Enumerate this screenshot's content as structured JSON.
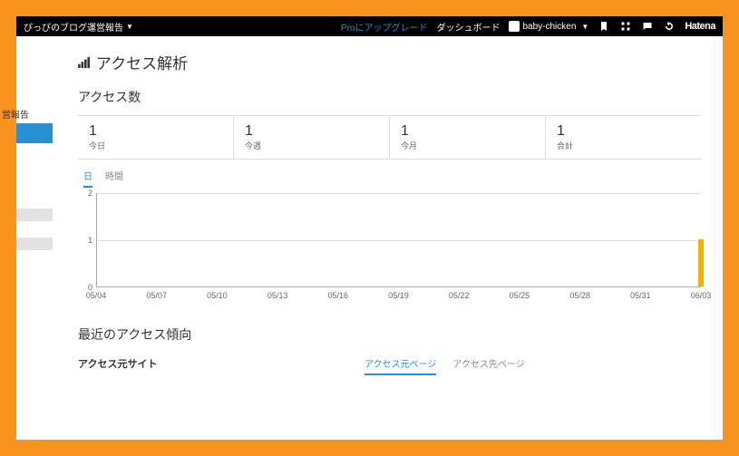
{
  "topbar": {
    "blog_title": "ぴっぴのブログ運営報告",
    "pro_link": "Proにアップグレード",
    "dashboard": "ダッシュボード",
    "username": "baby-chicken",
    "brand": "Hatena"
  },
  "sidebar": {
    "label": "営報告"
  },
  "page": {
    "title": "アクセス解析",
    "section_count": "アクセス数",
    "section_trend": "最近のアクセス傾向",
    "src_label": "アクセス元サイト"
  },
  "stats": [
    {
      "value": "1",
      "label": "今日"
    },
    {
      "value": "1",
      "label": "今週"
    },
    {
      "value": "1",
      "label": "今月"
    },
    {
      "value": "1",
      "label": "合計"
    }
  ],
  "chart_tabs": {
    "day": "日",
    "hour": "時間"
  },
  "src_tabs": {
    "src_page": "アクセス元ページ",
    "dst_page": "アクセス先ページ"
  },
  "chart_data": {
    "type": "bar",
    "categories": [
      "05/04",
      "05/07",
      "05/10",
      "05/13",
      "05/16",
      "05/19",
      "05/22",
      "05/25",
      "05/28",
      "05/31",
      "06/03"
    ],
    "values": [
      0,
      0,
      0,
      0,
      0,
      0,
      0,
      0,
      0,
      0,
      1
    ],
    "ylim": [
      0,
      2
    ],
    "yticks": [
      0,
      1,
      2
    ],
    "xlabel": "",
    "ylabel": "",
    "title": ""
  }
}
